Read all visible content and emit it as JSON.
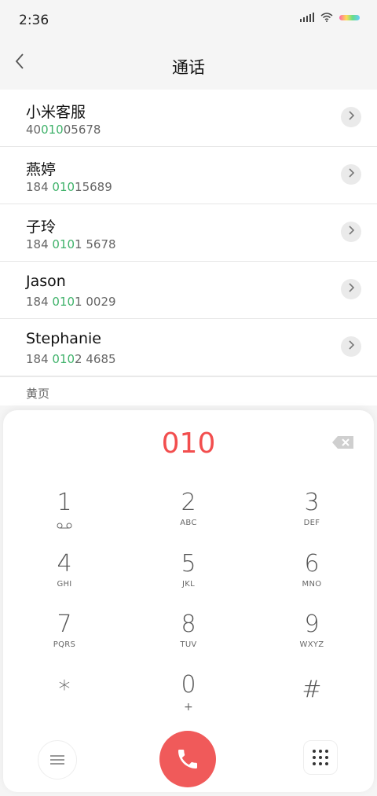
{
  "status": {
    "time": "2:36"
  },
  "header": {
    "title": "通话"
  },
  "contacts": [
    {
      "name": "小米客服",
      "num_pre": "40",
      "num_hl": "010",
      "num_post": "05678"
    },
    {
      "name": "燕婷",
      "num_pre": "184 ",
      "num_hl": "010",
      "num_post": "15689"
    },
    {
      "name": "子玲",
      "num_pre": "184 ",
      "num_hl": "010",
      "num_post": "1 5678"
    },
    {
      "name": "Jason",
      "num_pre": "184 ",
      "num_hl": "010",
      "num_post": "1 0029"
    },
    {
      "name": "Stephanie",
      "num_pre": "184 ",
      "num_hl": "010",
      "num_post": "2 4685"
    }
  ],
  "section": {
    "label": "黄页"
  },
  "dialer": {
    "display": "010",
    "keys": [
      {
        "digit": "1",
        "letters": ""
      },
      {
        "digit": "2",
        "letters": "ABC"
      },
      {
        "digit": "3",
        "letters": "DEF"
      },
      {
        "digit": "4",
        "letters": "GHI"
      },
      {
        "digit": "5",
        "letters": "JKL"
      },
      {
        "digit": "6",
        "letters": "MNO"
      },
      {
        "digit": "7",
        "letters": "PQRS"
      },
      {
        "digit": "8",
        "letters": "TUV"
      },
      {
        "digit": "9",
        "letters": "WXYZ"
      },
      {
        "digit": "*",
        "letters": ""
      },
      {
        "digit": "0",
        "letters": "+"
      },
      {
        "digit": "#",
        "letters": ""
      }
    ]
  },
  "colors": {
    "accent": "#f24e4e",
    "highlight": "#3fb26a",
    "call": "#f05a5a"
  },
  "icons": {
    "back": "chevron-left-icon",
    "chevron": "chevron-right-icon",
    "backspace": "backspace-icon",
    "voicemail": "voicemail-icon",
    "call": "phone-icon",
    "menu": "menu-icon",
    "dialpad": "dialpad-icon"
  }
}
